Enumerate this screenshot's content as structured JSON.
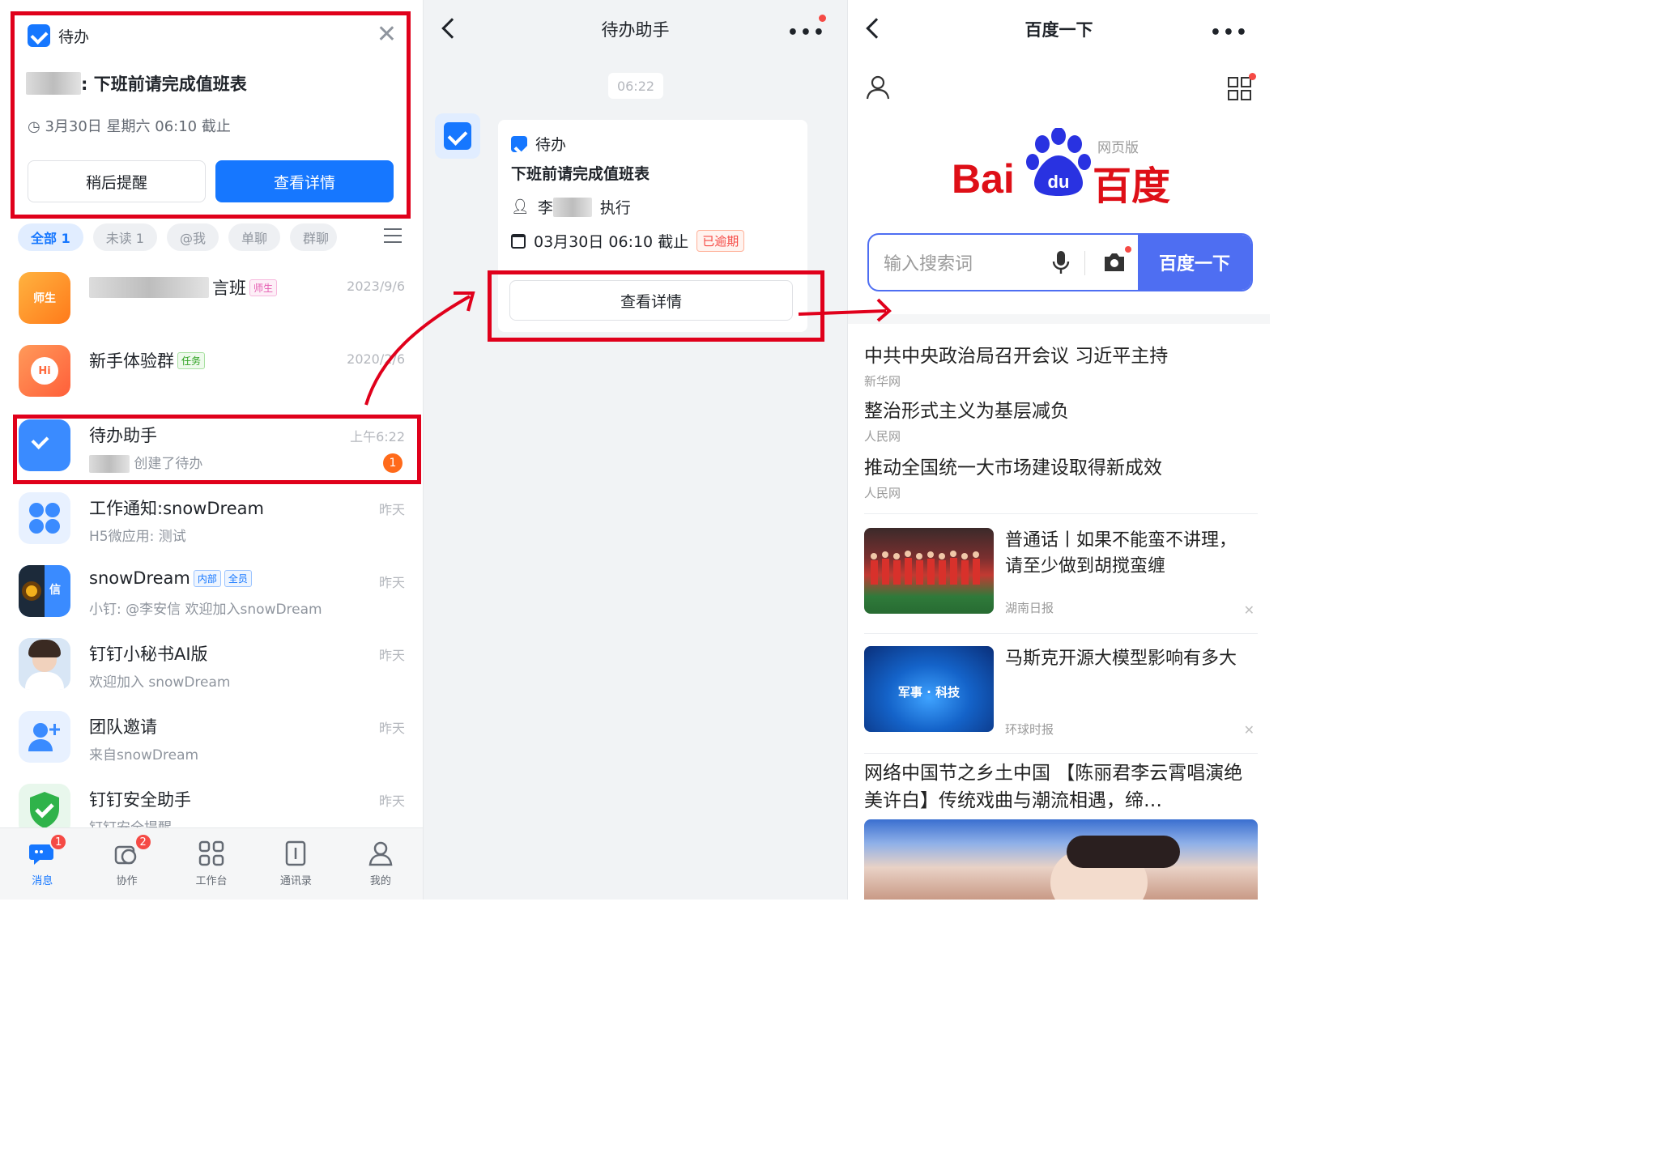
{
  "notification": {
    "app": "待办",
    "title_suffix": ": 下班前请完成值班表",
    "deadline": "3月30日 星期六 06:10 截止",
    "btn_later": "稍后提醒",
    "btn_view": "查看详情"
  },
  "filters": [
    "全部 1",
    "未读 1",
    "@我",
    "单聊",
    "群聊"
  ],
  "conversations": [
    {
      "name_suffix": "言班",
      "tag": "师生",
      "time": "2023/9/6",
      "sub": "",
      "avatar_text": "师生",
      "color": "#ff8a1f"
    },
    {
      "name": "新手体验群",
      "tag": "任务",
      "time": "2020/2/6",
      "sub": "",
      "avatar_text": "Hi",
      "color": "#ff7a45"
    },
    {
      "name": "待办助手",
      "time": "上午6:22",
      "sub": "创建了待办",
      "badge": "1",
      "color": "#3a8bff"
    },
    {
      "name": "工作通知:snowDream",
      "time": "昨天",
      "sub": "H5微应用: 测试",
      "color": "#e8f1ff"
    },
    {
      "name": "snowDream",
      "tags": [
        "内部",
        "全员"
      ],
      "time": "昨天",
      "sub": "小钉: @李安信 欢迎加入snowDream",
      "avatar_text": "信",
      "color": "#3a8bff"
    },
    {
      "name": "钉钉小秘书AI版",
      "time": "昨天",
      "sub": "欢迎加入 snowDream",
      "color": "#d8e6f5"
    },
    {
      "name": "团队邀请",
      "time": "昨天",
      "sub": "来自snowDream",
      "color": "#e8f1ff"
    },
    {
      "name": "钉钉安全助手",
      "time": "昨天",
      "sub": "钉钉安全提醒",
      "color": "#e8f7ec"
    }
  ],
  "tabbar": [
    {
      "label": "消息",
      "badge": "1"
    },
    {
      "label": "协作",
      "badge": "2"
    },
    {
      "label": "工作台"
    },
    {
      "label": "通讯录"
    },
    {
      "label": "我的"
    }
  ],
  "chat": {
    "title": "待办助手",
    "time": "06:22",
    "card_app": "待办",
    "card_title": "下班前请完成值班表",
    "executor_prefix": "李",
    "executor_suffix": "执行",
    "deadline": "03月30日 06:10 截止",
    "status": "已逾期",
    "view_btn": "查看详情"
  },
  "baidu": {
    "title": "百度一下",
    "logo_tag": "网页版",
    "logo_cn": "百度",
    "search_placeholder": "输入搜索词",
    "search_btn": "百度一下",
    "hot": [
      {
        "title": "中共中央政治局召开会议 习近平主持",
        "source": "新华网"
      },
      {
        "title": "整治形式主义为基层减负",
        "source": "人民网"
      },
      {
        "title": "推动全国统一大市场建设取得新成效",
        "source": "人民网"
      }
    ],
    "feed": [
      {
        "title": "普通话丨如果不能蛮不讲理，请至少做到胡搅蛮缠",
        "source": "湖南日报"
      },
      {
        "title": "马斯克开源大模型影响有多大",
        "source": "环球时报",
        "thumb_text": "军事 · 科技"
      }
    ],
    "bottom_title": "网络中国节之乡土中国 【陈丽君李云霄唱演绝美许白】传统戏曲与潮流相遇，缔…"
  }
}
